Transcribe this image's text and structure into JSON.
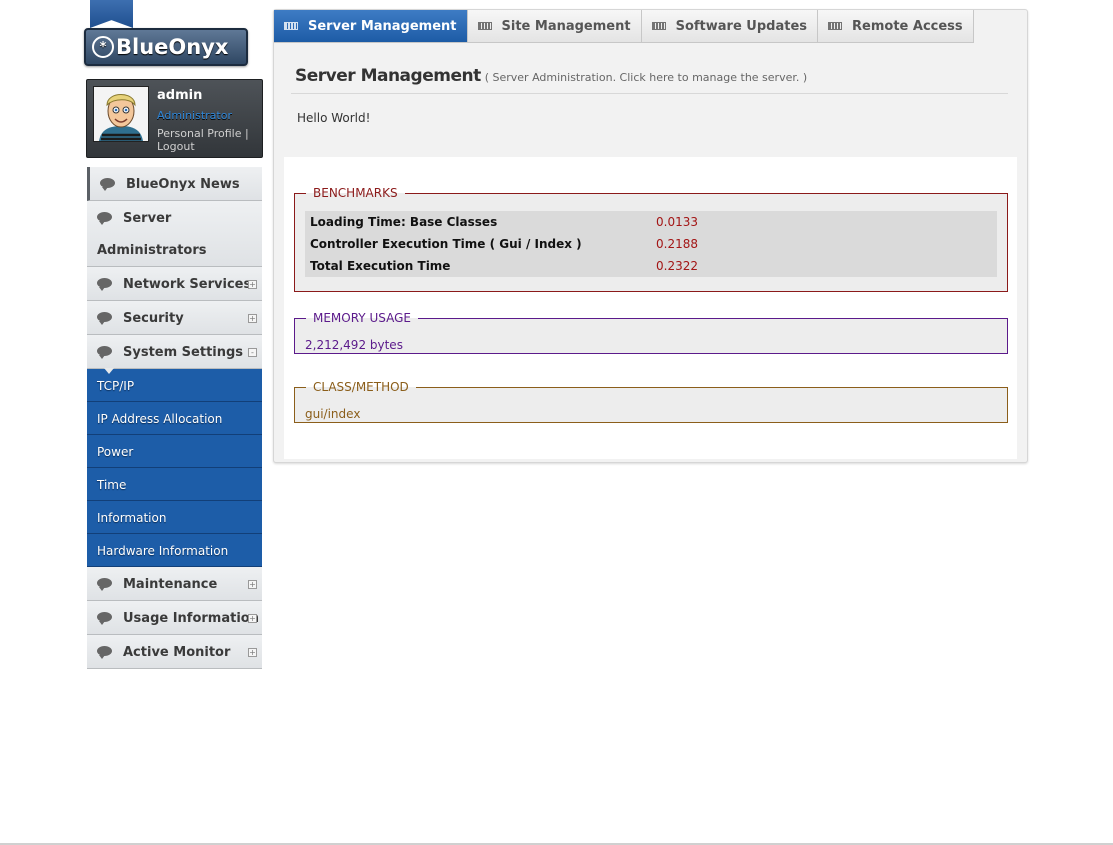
{
  "brand": {
    "logo_text": "BlueOnyx",
    "logo_mark": "*"
  },
  "user": {
    "name": "admin",
    "role": "Administrator",
    "link_profile": "Personal Profile",
    "link_separator": "|",
    "link_logout": "Logout"
  },
  "sidebar": {
    "items": [
      {
        "label": "BlueOnyx News"
      },
      {
        "label_line1": "Server",
        "label_line2": "Administrators"
      },
      {
        "label": "Network Services",
        "toggle": "+"
      },
      {
        "label": "Security",
        "toggle": "+"
      },
      {
        "label": "System Settings",
        "toggle": "-"
      },
      {
        "label": "Maintenance",
        "toggle": "+"
      },
      {
        "label": "Usage Information",
        "toggle": "+"
      },
      {
        "label": "Active Monitor",
        "toggle": "+"
      }
    ],
    "subitems": [
      {
        "label": "TCP/IP"
      },
      {
        "label": "IP Address Allocation"
      },
      {
        "label": "Power"
      },
      {
        "label": "Time"
      },
      {
        "label": "Information"
      },
      {
        "label": "Hardware Information"
      }
    ]
  },
  "tabs": [
    {
      "label": "Server Management",
      "active": true
    },
    {
      "label": "Site Management"
    },
    {
      "label": "Software Updates"
    },
    {
      "label": "Remote Access"
    }
  ],
  "page": {
    "title": "Server Management",
    "subtitle": "( Server Administration. Click here to manage the server. )",
    "body_text": "Hello World!"
  },
  "debug": {
    "benchmarks": {
      "legend": "BENCHMARKS",
      "rows": [
        {
          "label": "Loading Time: Base Classes",
          "value": "0.0133"
        },
        {
          "label": "Controller Execution Time ( Gui / Index )",
          "value": "0.2188"
        },
        {
          "label": "Total Execution Time",
          "value": "0.2322"
        }
      ]
    },
    "memory": {
      "legend": "MEMORY USAGE",
      "value": "2,212,492 bytes"
    },
    "class_method": {
      "legend": "CLASS/METHOD",
      "value": "gui/index"
    }
  },
  "colors": {
    "nav_active": "#1d5da8",
    "benchmark": "#8b1a1a",
    "memory": "#5b1a8b",
    "class_method": "#8b5e1a"
  },
  "icons": {
    "sidebar_bullet": "speech-bubble-icon",
    "tab": "server-icon",
    "toggle": "expand-icon"
  }
}
